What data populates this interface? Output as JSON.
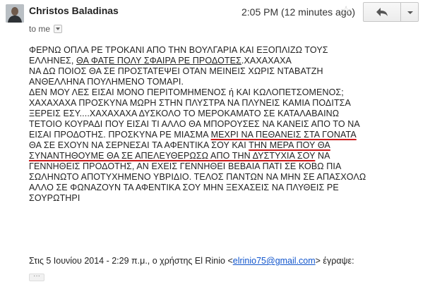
{
  "header": {
    "sender_name": "Christos Baladinas",
    "recipient_label": "to me",
    "timestamp": "2:05 PM (12 minutes ago)",
    "star_icon": "star-outline-icon",
    "reply_icon": "reply-arrow-icon",
    "more_icon": "chevron-down-icon"
  },
  "message": {
    "line1": "ΦΕΡΝΩ ΟΠΛΑ ΡΕ ΤΡΟΚΑΝΙ ΑΠΟ ΤΗΝ ΒΟΥΛΓΑΡΙΑ ΚΑΙ ΕΞΟΠΛΙΖΩ ΤΟΥΣ",
    "line2_pre": "ΕΛΛΗΝΕΣ, ",
    "line2_ul": "ΘΑ ΦΑΤΕ ΠΟΛΥ ΣΦΑΙΡΑ ΡΕ ΠΡΟΔΟΤΕΣ",
    "line2_post": ".ΧΑΧΑΧΑΧΑ",
    "line3": "ΝΑ ΔΩ ΠΟΙΟΣ ΘΑ ΣΕ ΠΡΟΣΤΑΤΕΨΕΙ ΟΤΑΝ ΜΕΙΝΕΙΣ ΧΩΡΙΣ ΝΤΑΒΑΤΖΗ",
    "line4": "ΑΝΘΕΛΛΗΝΑ ΠΟΥΛΗΜΕΝΟ ΤΟΜΑΡΙ.",
    "line5": "ΔΕΝ ΜΟΥ ΛΕΣ ΕΙΣΑΙ ΜΟΝΟ ΠΕΡΙΤΟΜΗΜΕΝΟΣ ή ΚΑΙ ΚΩΛΟΠΕΤΣΟΜΕΝΟΣ;",
    "line6": "ΧΑΧΑΧΑΧΑ ΠΡΟΣΚΥΝΑ ΜΩΡΗ ΣΤΗΝ ΠΛΥΣΤΡΑ ΝΑ ΠΛΥΝΕΙΣ ΚΑΜΙΑ ΠΟΔΙΤΣΑ",
    "line7": "ΞΕΡΕΙΣ ΕΣΥ....ΧΑΧΑΧΑΧΑ ΔΥΣΚΟΛΟ ΤΟ ΜΕΡΟΚΑΜΑΤΟ ΣΕ ΚΑΤΑΛΑΒΑΙΝΩ",
    "line8": "ΤΕΤΟΙΟ ΚΟΥΡΑΔΙ ΠΟΥ ΕΙΣΑΙ ΤΙ ΑΛΛΟ ΘΑ ΜΠΟΡΟΥΣΕΣ ΝΑ ΚΑΝΕΙΣ ΑΠΟ ΤΟ ΝΑ",
    "line9_pre": "ΕΙΣΑΙ ΠΡΟΔΟΤΗΣ. ΠΡΟΣΚΥΝΑ ΡΕ ΜΙΑΣΜΑ ",
    "line9_ul": "ΜΕΧΡΙ ΝΑ ΠΕΘΑΝΕΙΣ ΣΤΑ ΓΟΝΑΤΑ",
    "line10_pre": "ΘΑ ΣΕ ΕΧΟΥΝ ΝΑ ΣΕΡΝΕΣΑΙ ΤΑ ΑΦΕΝΤΙΚΑ ΣΟΥ ΚΑΙ ",
    "line10_ul": "ΤΗΝ ΜΕΡΑ ΠΟΥ ΘΑ",
    "line11_ul": "ΣΥΝΑΝΤΗΘΟΥΜΕ ΘΑ ΣΕ ΑΠΕΛΕΥΘΕΡΩΣΩ ΑΠΟ ΤΗΝ ΔΥΣΤΥΧΙΑ ΣΟΥ",
    "line11_post": " ΝΑ",
    "line12": "ΓΕΝΝΗΘΕΙΣ ΠΡΟΔΟΤΗΣ, ΑΝ ΕΧΕΙΣ ΓΕΝΝΗΘΕΙ ΒΕΒΑΙΑ ΠΑΤΙ ΣΕ ΚΟΒΩ ΠΙΑ",
    "line13": "ΣΩΛΗΝΩΤΟ ΑΠΟΤΥΧΗΜΕΝΟ ΥΒΡΙΔΙΟ. ΤΕΛΟΣ ΠΑΝΤΩΝ ΝΑ ΜΗΝ ΣΕ ΑΠΑΣΧΟΛΩ",
    "line14": "ΑΛΛΟ ΣΕ ΦΩΝΑΖΟΥΝ ΤΑ ΑΦΕΝΤΙΚΑ ΣΟΥ ΜΗΝ ΞΕΧΑΣΕΙΣ ΝΑ ΠΛΥΘΕΙΣ ΡΕ",
    "line15": "ΣΟΥΡΩΤΗΡΙ"
  },
  "quote": {
    "prefix": "Στις 5 Ιουνίου 2014 - 2:29 π.μ., ο χρήστης El Rinio <",
    "email": "elrinio75@gmail.com",
    "suffix": "> έγραψε:"
  },
  "trimmed_label": "···"
}
